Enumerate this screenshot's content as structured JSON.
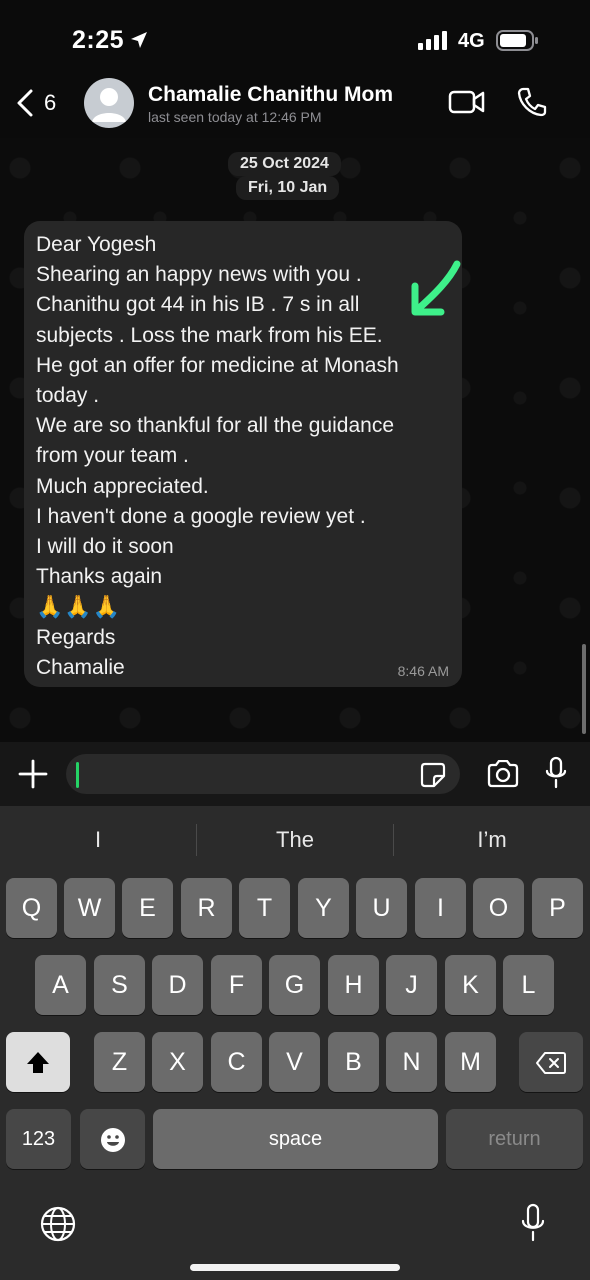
{
  "status_bar": {
    "time": "2:25",
    "network": "4G"
  },
  "header": {
    "back_count": "6",
    "contact_name": "Chamalie Chanithu Mom",
    "last_seen": "last seen today at 12:46 PM"
  },
  "chat": {
    "date_chips": [
      "25 Oct 2024",
      "Fri, 10 Jan"
    ],
    "message": {
      "lines": [
        "Dear Yogesh",
        "Shearing an happy news with you .",
        "Chanithu got 44 in his IB . 7 s in all",
        "subjects . Loss the mark from his EE.",
        "He got an offer for medicine at Monash",
        "today .",
        "We are so thankful for all the guidance",
        "from your team .",
        "Much appreciated.",
        "I haven't done a  google review yet .",
        "I will do it soon",
        "Thanks again",
        "🙏🙏🙏",
        "Regards",
        "Chamalie"
      ],
      "time": "8:46 AM"
    }
  },
  "composer": {
    "input_value": ""
  },
  "keyboard": {
    "suggestions": [
      "I",
      "The",
      "I’m"
    ],
    "row1": [
      "Q",
      "W",
      "E",
      "R",
      "T",
      "Y",
      "U",
      "I",
      "O",
      "P"
    ],
    "row2": [
      "A",
      "S",
      "D",
      "F",
      "G",
      "H",
      "J",
      "K",
      "L"
    ],
    "row3": [
      "Z",
      "X",
      "C",
      "V",
      "B",
      "N",
      "M"
    ],
    "numbers_label": "123",
    "space_label": "space",
    "return_label": "return"
  },
  "colors": {
    "background": "#0b0b0b",
    "bubble": "#272727",
    "accent_green": "#25d366",
    "annotation_arrow": "#3ef08a"
  },
  "icons": [
    "location-arrow-icon",
    "signal-icon",
    "battery-icon",
    "back-chevron-icon",
    "avatar-icon",
    "video-call-icon",
    "phone-icon",
    "annotation-arrow-icon",
    "plus-icon",
    "sticker-icon",
    "camera-icon",
    "microphone-icon",
    "shift-icon",
    "backspace-icon",
    "emoji-icon",
    "globe-icon",
    "dictation-mic-icon"
  ]
}
